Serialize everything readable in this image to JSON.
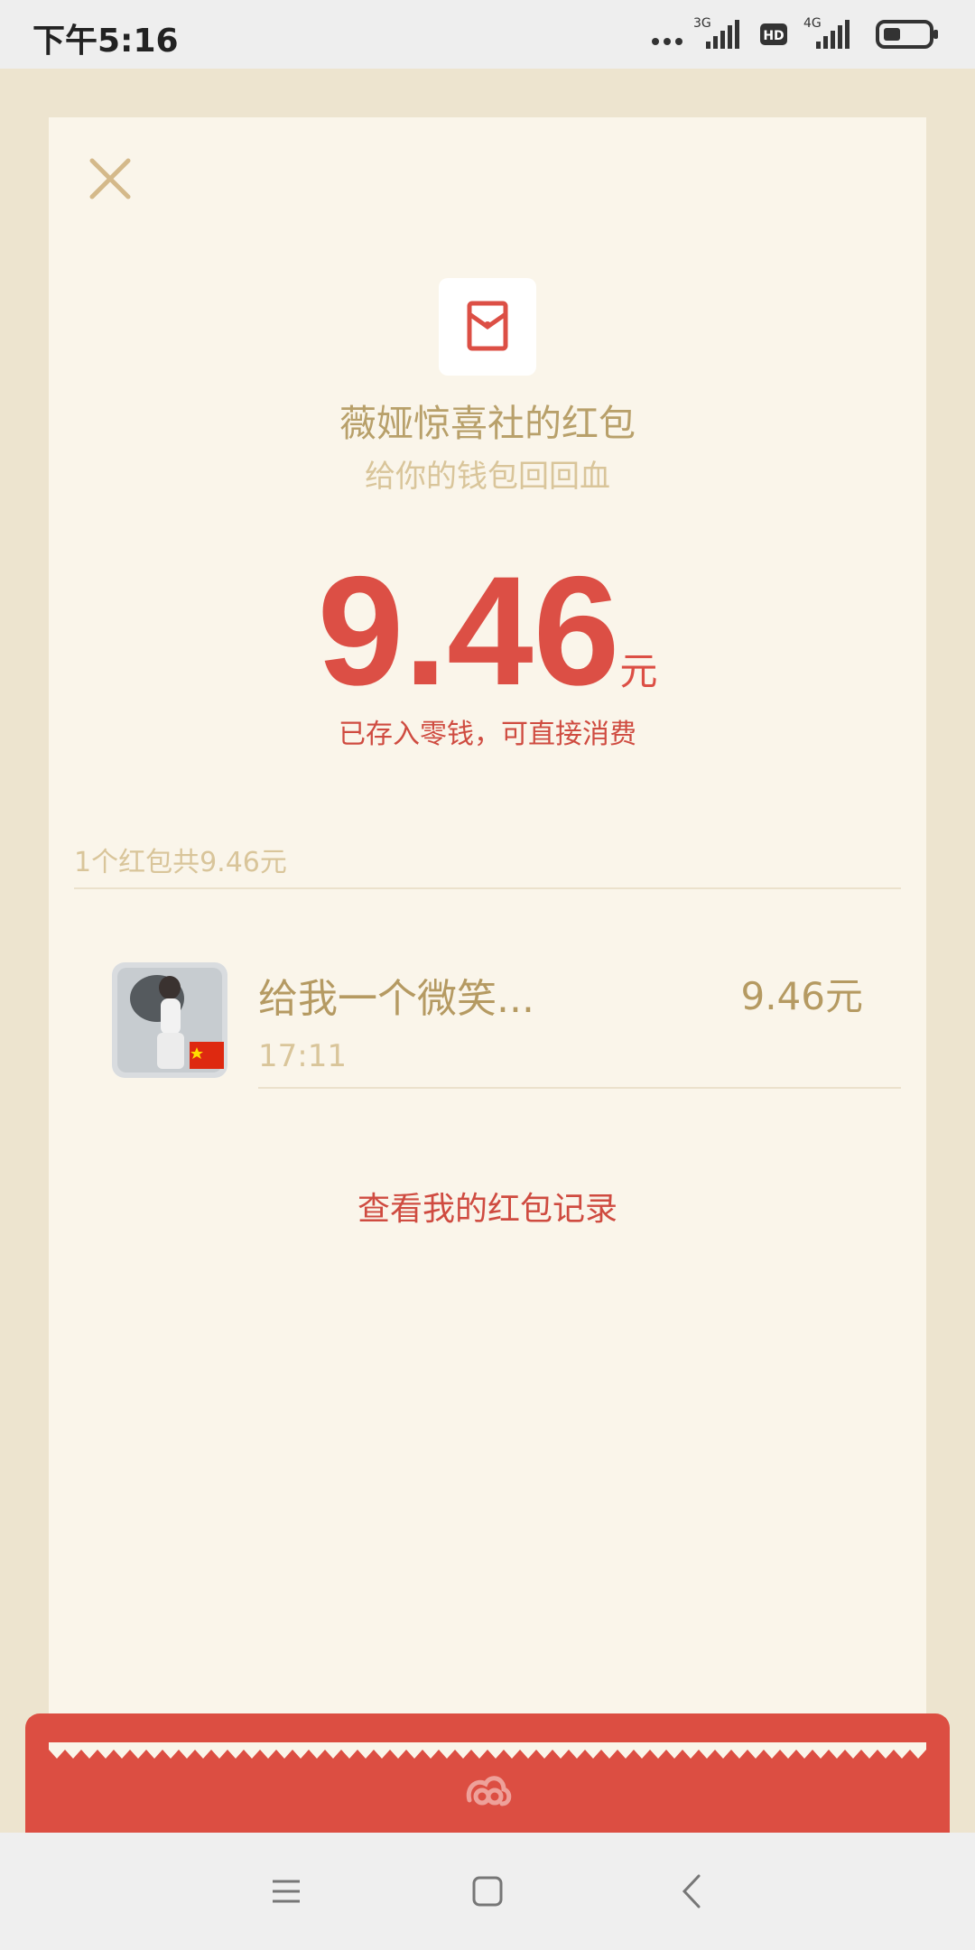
{
  "status_bar": {
    "time": "下午5:16",
    "network_1": "3G",
    "hd_badge": "HD",
    "network_2": "4G"
  },
  "packet": {
    "sender_title": "薇娅惊喜社的红包",
    "blessing": "给你的钱包回回血",
    "amount": "9.46",
    "unit": "元",
    "deposit_note": "已存入零钱，可直接消费"
  },
  "summary": "1个红包共9.46元",
  "records": [
    {
      "name": "给我一个微笑...",
      "time": "17:11",
      "amount": "9.46元"
    }
  ],
  "view_records_label": "查看我的红包记录",
  "colors": {
    "accent_red": "#dc4f45",
    "gold_text": "#b8a06a",
    "card_bg": "#faf5ea"
  },
  "icons": [
    "close-icon",
    "red-packet-icon",
    "cloud-icon",
    "menu-icon",
    "home-icon",
    "back-icon"
  ]
}
